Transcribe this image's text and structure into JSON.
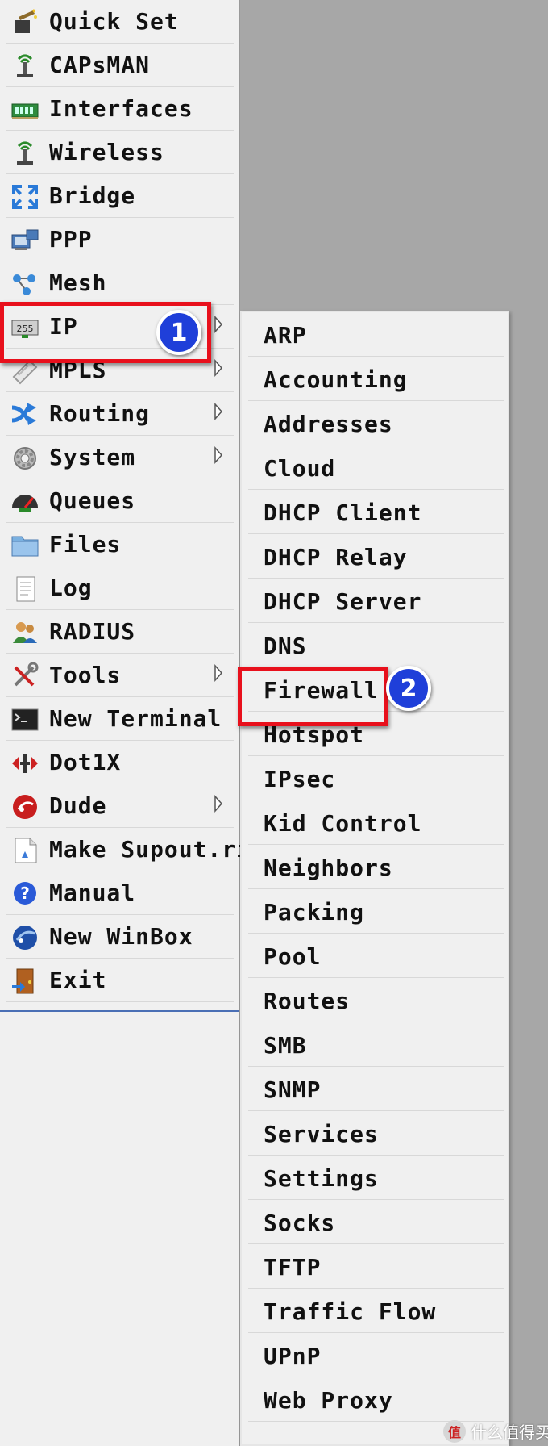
{
  "left_menu": [
    {
      "label": "Quick Set",
      "icon": "quick-set-icon"
    },
    {
      "label": "CAPsMAN",
      "icon": "capsman-icon"
    },
    {
      "label": "Interfaces",
      "icon": "interfaces-icon"
    },
    {
      "label": "Wireless",
      "icon": "wireless-icon"
    },
    {
      "label": "Bridge",
      "icon": "bridge-icon"
    },
    {
      "label": "PPP",
      "icon": "ppp-icon"
    },
    {
      "label": "Mesh",
      "icon": "mesh-icon"
    },
    {
      "label": "IP",
      "icon": "ip-icon"
    },
    {
      "label": "MPLS",
      "icon": "mpls-icon"
    },
    {
      "label": "Routing",
      "icon": "routing-icon"
    },
    {
      "label": "System",
      "icon": "system-icon"
    },
    {
      "label": "Queues",
      "icon": "queues-icon"
    },
    {
      "label": "Files",
      "icon": "files-icon"
    },
    {
      "label": "Log",
      "icon": "log-icon"
    },
    {
      "label": "RADIUS",
      "icon": "radius-icon"
    },
    {
      "label": "Tools",
      "icon": "tools-icon"
    },
    {
      "label": "New Terminal",
      "icon": "terminal-icon"
    },
    {
      "label": "Dot1X",
      "icon": "dot1x-icon"
    },
    {
      "label": "Dude",
      "icon": "dude-icon"
    },
    {
      "label": "Make Supout.rif",
      "icon": "supout-icon"
    },
    {
      "label": "Manual",
      "icon": "manual-icon"
    },
    {
      "label": "New WinBox",
      "icon": "winbox-icon"
    },
    {
      "label": "Exit",
      "icon": "exit-icon"
    }
  ],
  "ip_submenu": [
    "ARP",
    "Accounting",
    "Addresses",
    "Cloud",
    "DHCP Client",
    "DHCP Relay",
    "DHCP Server",
    "DNS",
    "Firewall",
    "Hotspot",
    "IPsec",
    "Kid Control",
    "Neighbors",
    "Packing",
    "Pool",
    "Routes",
    "SMB",
    "SNMP",
    "Services",
    "Settings",
    "Socks",
    "TFTP",
    "Traffic Flow",
    "UPnP",
    "Web Proxy"
  ],
  "callouts": [
    {
      "number": "1",
      "target": "IP"
    },
    {
      "number": "2",
      "target": "Firewall"
    }
  ],
  "colors": {
    "highlight": "#e8101c",
    "badge": "#1f3fd9"
  },
  "watermark": {
    "logo": "值",
    "text": "什么值得买"
  }
}
